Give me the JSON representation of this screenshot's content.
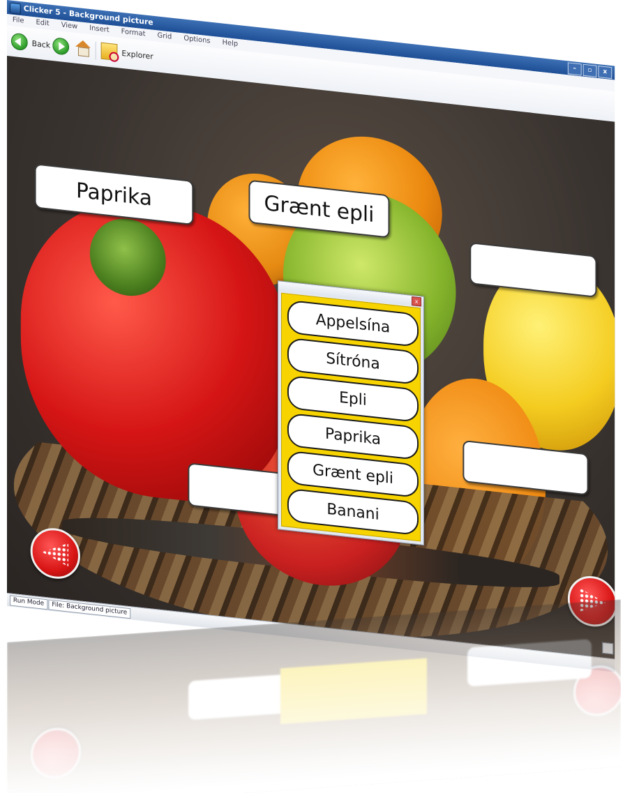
{
  "window": {
    "title": "Clicker 5 - Background picture",
    "controls": [
      "–",
      "▫",
      "x"
    ]
  },
  "menu": [
    "File",
    "Edit",
    "View",
    "Insert",
    "Format",
    "Grid",
    "Options",
    "Help"
  ],
  "toolbar": {
    "back_label": "Back",
    "explorer_label": "Explorer"
  },
  "labels": {
    "paprika": "Paprika",
    "graent_epli": "Grænt epli"
  },
  "wordlist": {
    "close_glyph": "x",
    "items": [
      "Appelsína",
      "Sítróna",
      "Epli",
      "Paprika",
      "Grænt epli",
      "Banani"
    ]
  },
  "statusbar": {
    "mode": "Run Mode",
    "file": "File: Background picture"
  },
  "colors": {
    "popup_bg": "#f7d400",
    "nav_button": "#d81515"
  }
}
